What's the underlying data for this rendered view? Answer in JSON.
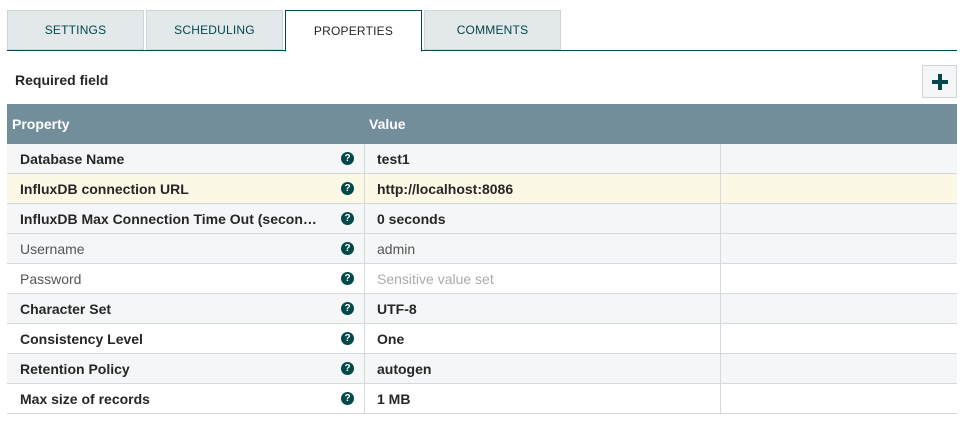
{
  "tabs": [
    {
      "label": "SETTINGS"
    },
    {
      "label": "SCHEDULING"
    },
    {
      "label": "PROPERTIES"
    },
    {
      "label": "COMMENTS"
    }
  ],
  "required_label": "Required field",
  "table": {
    "headers": {
      "property": "Property",
      "value": "Value"
    },
    "rows": [
      {
        "name": "Database Name",
        "value": "test1"
      },
      {
        "name": "InfluxDB connection URL",
        "value": "http://localhost:8086"
      },
      {
        "name": "InfluxDB Max Connection Time Out (secon…",
        "value": "0 seconds"
      },
      {
        "name": "Username",
        "value": "admin"
      },
      {
        "name": "Password",
        "value": "Sensitive value set"
      },
      {
        "name": "Character Set",
        "value": "UTF-8"
      },
      {
        "name": "Consistency Level",
        "value": "One"
      },
      {
        "name": "Retention Policy",
        "value": "autogen"
      },
      {
        "name": "Max size of records",
        "value": "1 MB"
      }
    ]
  },
  "help_glyph": "?",
  "colors": {
    "accent": "#004849",
    "header_bg": "#728e9b",
    "highlight_row": "#fcf8e6"
  }
}
